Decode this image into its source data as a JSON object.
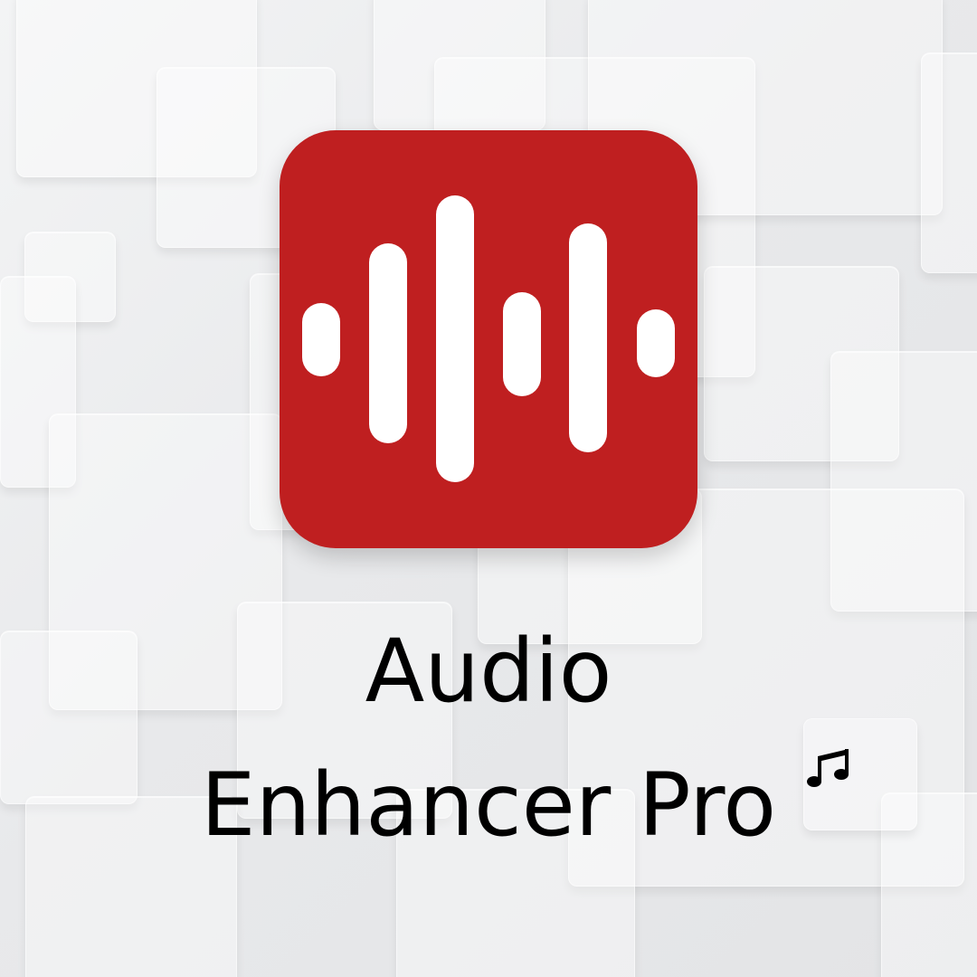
{
  "app": {
    "title_line1": "Audio",
    "title_line2": "Enhancer Pro",
    "icon": "waveform-icon",
    "badge_icon": "music-note-icon"
  },
  "colors": {
    "brand_red": "#bf1f20",
    "bar_white": "#ffffff",
    "text_black": "#000000",
    "background": "#e9eaec"
  }
}
